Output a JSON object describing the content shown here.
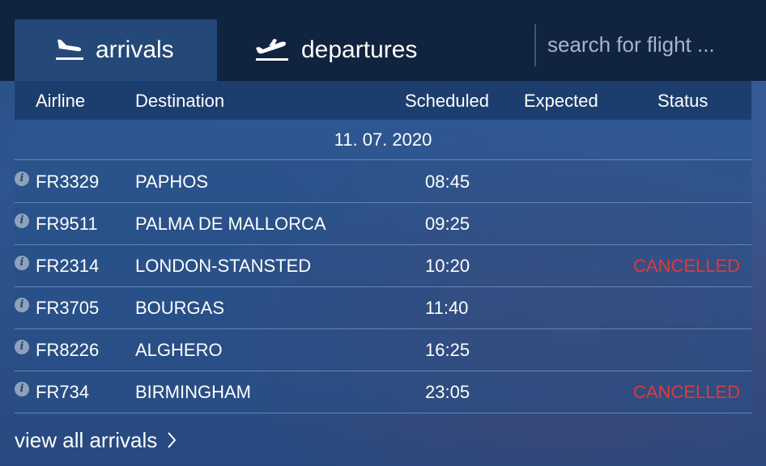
{
  "tabs": {
    "arrivals_label": "arrivals",
    "departures_label": "departures"
  },
  "search": {
    "placeholder": "search for flight ..."
  },
  "columns": {
    "airline": "Airline",
    "destination": "Destination",
    "scheduled": "Scheduled",
    "expected": "Expected",
    "status": "Status"
  },
  "date": "11. 07. 2020",
  "flights": [
    {
      "flight": "FR3329",
      "destination": "PAPHOS",
      "scheduled": "08:45",
      "expected": "",
      "status": ""
    },
    {
      "flight": "FR9511",
      "destination": "PALMA DE MALLORCA",
      "scheduled": "09:25",
      "expected": "",
      "status": ""
    },
    {
      "flight": "FR2314",
      "destination": "LONDON-STANSTED",
      "scheduled": "10:20",
      "expected": "",
      "status": "CANCELLED"
    },
    {
      "flight": "FR3705",
      "destination": "BOURGAS",
      "scheduled": "11:40",
      "expected": "",
      "status": ""
    },
    {
      "flight": "FR8226",
      "destination": "ALGHERO",
      "scheduled": "16:25",
      "expected": "",
      "status": ""
    },
    {
      "flight": "FR734",
      "destination": "BIRMINGHAM",
      "scheduled": "23:05",
      "expected": "",
      "status": "CANCELLED"
    }
  ],
  "footer": {
    "view_all_label": "view all arrivals"
  },
  "colors": {
    "topbar": "#10233f",
    "active_tab": "#244878",
    "cancelled": "#e0393b"
  },
  "icons": {
    "arrivals": "plane-landing-icon",
    "departures": "plane-takeoff-icon",
    "info": "info-icon",
    "chevron": "chevron-right-icon"
  }
}
